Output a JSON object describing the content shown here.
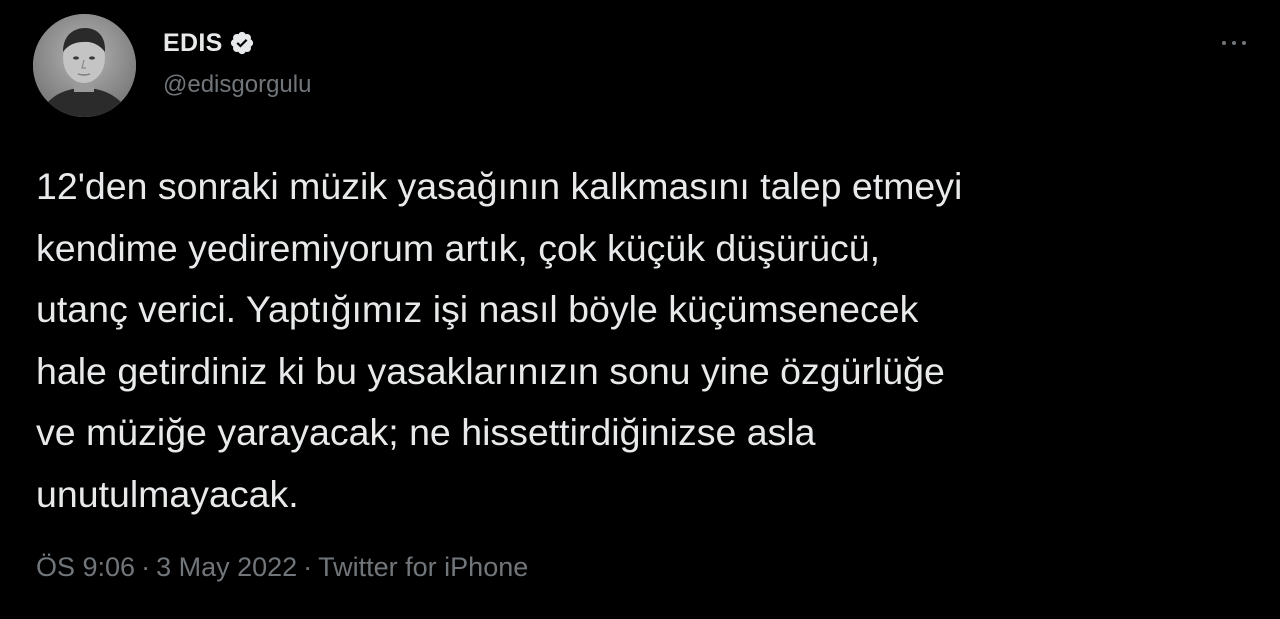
{
  "author": {
    "display_name": "EDIS",
    "handle": "@edisgorgulu",
    "verified": true,
    "avatar_icon": "avatar-photo"
  },
  "more_icon": "more-horizontal-icon",
  "tweet": {
    "lines": [
      "12'den sonraki müzik yasağının kalkmasını talep etmeyi",
      "kendime yediremiyorum artık, çok küçük düşürücü,",
      "utanç verici. Yaptığımız işi nasıl böyle küçümsenecek",
      "hale getirdiniz ki bu yasaklarınızın sonu yine özgürlüğe",
      "ve müziğe yarayacak; ne hissettirdiğinizse asla",
      "unutulmayacak."
    ]
  },
  "meta": {
    "time": "ÖS 9:06",
    "separator": "·",
    "date": "3 May 2022",
    "source": "Twitter for iPhone"
  },
  "colors": {
    "background": "#000000",
    "text_primary": "#e7e9ea",
    "text_secondary": "#71767b",
    "verified_badge": "#e7e9ea"
  }
}
